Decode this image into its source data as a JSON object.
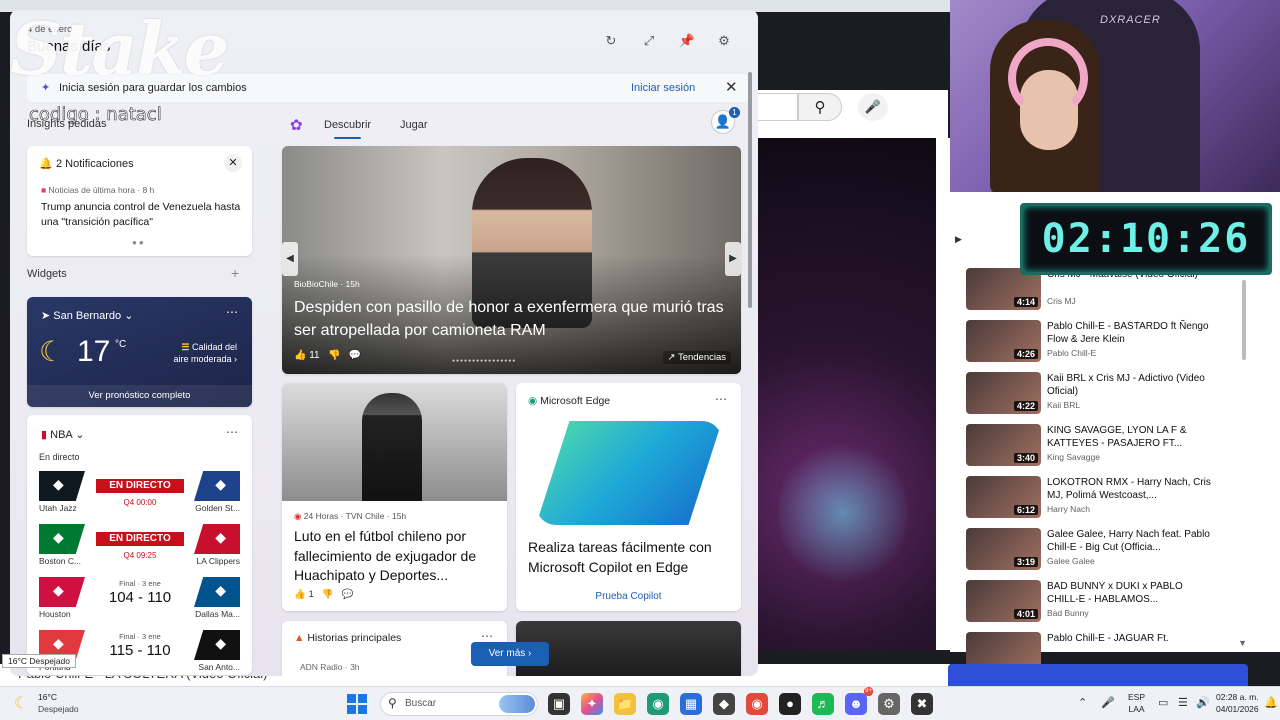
{
  "panel": {
    "date": "4 de enero",
    "greeting": "Buenas días",
    "overlay_brand": "Stake",
    "overlay_code": "codigo : natacl",
    "signin_text": "Inicia sesión para guardar los cambios",
    "signin_link": "Iniciar sesión",
    "insights_label": "Insights pedidas",
    "tabs": [
      {
        "label": "Descubrir"
      },
      {
        "label": "Jugar"
      }
    ],
    "avatar_badge": "1",
    "widgets_label": "Widgets",
    "see_more": "Ver más"
  },
  "notifications": {
    "title": "2 Notificaciones",
    "source": "Noticias de última hora · 8 h",
    "body": "Trump anuncia control de Venezuela hasta una \"transición pacífica\""
  },
  "weather": {
    "location": "San Bernardo",
    "temp": "17",
    "unit": "°C",
    "air_quality": "Calidad del aire moderada",
    "forecast_link": "Ver pronóstico completo"
  },
  "nba": {
    "title": "NBA",
    "live_label": "En directo",
    "games": [
      {
        "left": "Utah Jazz",
        "right": "Golden St...",
        "state": "EN DIRECTO",
        "detail": "Q4 00:00",
        "left_color": "#101820",
        "right_color": "#1d428a"
      },
      {
        "left": "Boston C...",
        "right": "LA Clippers",
        "state": "EN DIRECTO",
        "detail": "Q4 09:25",
        "left_color": "#007a33",
        "right_color": "#c8102e"
      },
      {
        "left": "Houston",
        "right": "Dallas Ma...",
        "final": "Final · 3 ene",
        "score": "104 - 110",
        "left_color": "#ce1141",
        "right_color": "#00538c"
      },
      {
        "left": "Portland",
        "right": "San Anto...",
        "final": "Final · 3 ene",
        "score": "115 - 110",
        "left_color": "#e03a3e",
        "right_color": "#111111"
      }
    ]
  },
  "hero": {
    "source": "BioBioChile · 15h",
    "title": "Despiden con pasillo de honor a exenfermera que murió tras ser atropellada por camioneta RAM",
    "likes": "11",
    "trending": "Tendencias"
  },
  "football": {
    "source": "24 Horas · TVN Chile · 15h",
    "title": "Luto en el fútbol chileno por fallecimiento de exjugador de Huachipato y Deportes...",
    "likes": "1"
  },
  "edge": {
    "title": "Microsoft Edge",
    "body": "Realiza tareas fácilmente con Microsoft Copilot en Edge",
    "button": "Prueba Copilot"
  },
  "top_stories": {
    "title": "Historias principales",
    "source": "ADN Radio · 3h"
  },
  "tooltip": "16°C Despejado",
  "bottom_title": "Pablo Chill-E - LA SOLTERA (Video Oficial)",
  "timer": "02:10:26",
  "playlist": [
    {
      "title": "Cris MJ - Mauvaise (Video Oficial)",
      "channel": "Cris MJ",
      "duration": "4:14"
    },
    {
      "title": "Pablo Chill-E - BASTARDO ft Ñengo Flow & Jere Klein",
      "channel": "Pablo Chill-E",
      "duration": "4:26"
    },
    {
      "title": "Kaii BRL x Cris MJ - Adictivo (Video Oficial)",
      "channel": "Kaii BRL",
      "duration": "4:22"
    },
    {
      "title": "KING SAVAGGE, LYON LA F & KATTEYES - PASAJERO FT...",
      "channel": "King Savagge",
      "duration": "3:40"
    },
    {
      "title": "LOKOTRON RMX - Harry Nach, Cris MJ, Polimá Westcoast,...",
      "channel": "Harry Nach",
      "duration": "6:12"
    },
    {
      "title": "Galee Galee, Harry Nach feat. Pablo Chill-E - Big Cut (Officia...",
      "channel": "Galee Galee",
      "duration": "3:19"
    },
    {
      "title": "BAD BUNNY x DUKI x PABLO CHILL-E - HABLAMOS...",
      "channel": "Bad Bunny",
      "duration": "4:01"
    },
    {
      "title": "Pablo Chill-E - JAGUAR Ft.",
      "channel": "",
      "duration": ""
    }
  ],
  "taskbar": {
    "weather_temp": "16°C",
    "weather_desc": "Despejado",
    "search_placeholder": "Buscar",
    "lang_top": "ESP",
    "lang_bottom": "LAA",
    "time": "02:28 a. m.",
    "date": "04/01/2026",
    "discord_badge": "9+"
  },
  "colors": {
    "accent": "#1a5fb4",
    "live_red": "#c7101c",
    "weather_bg": "#2a3868"
  }
}
